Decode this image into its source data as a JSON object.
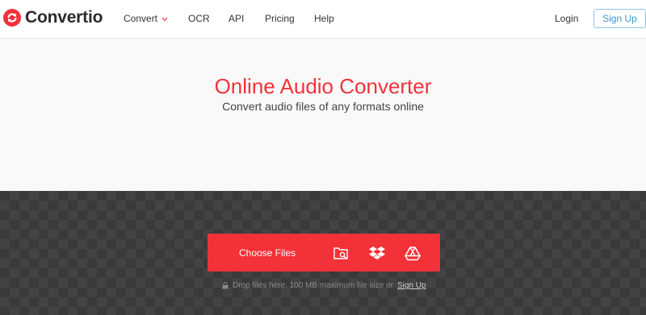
{
  "brand": {
    "name": "Convertio"
  },
  "nav": {
    "convert": "Convert",
    "ocr": "OCR",
    "api": "API",
    "pricing": "Pricing",
    "help": "Help"
  },
  "auth": {
    "login": "Login",
    "signup": "Sign Up"
  },
  "hero": {
    "title": "Online Audio Converter",
    "subtitle": "Convert audio files of any formats online"
  },
  "upload": {
    "choose_label": "Choose Files",
    "sources": [
      "folder-search-icon",
      "dropbox-icon",
      "google-drive-icon"
    ],
    "note_text": "Drop files here. 100 MB maximum file size or",
    "note_link": "Sign Up"
  },
  "colors": {
    "accent": "#f33138",
    "signup": "#3a99cf",
    "dark_bg": "#3a3a3a"
  }
}
